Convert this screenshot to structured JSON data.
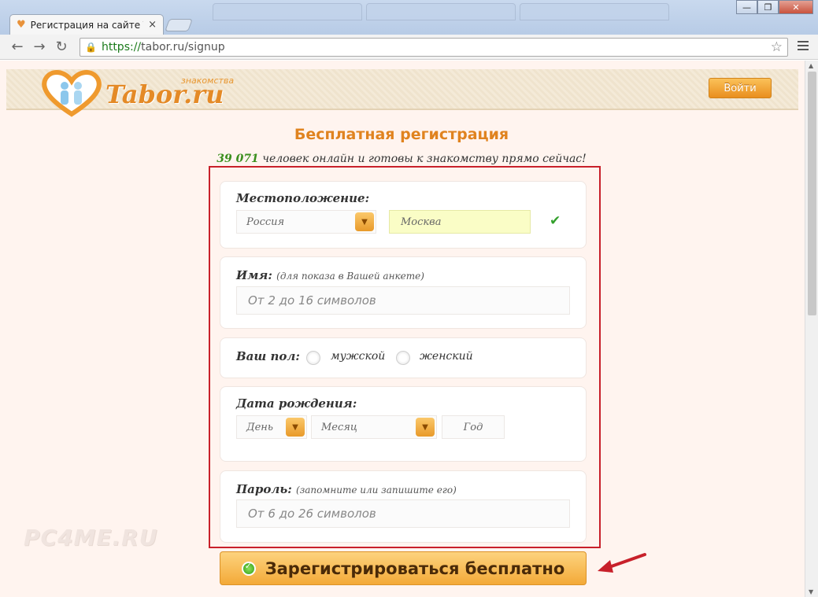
{
  "browser": {
    "tab_title": "Регистрация на сайте Tab",
    "tab_close": "×",
    "url_https": "https://",
    "url_rest": "tabor.ru/signup",
    "back_glyph": "←",
    "forward_glyph": "→",
    "reload_glyph": "↻",
    "star_glyph": "☆",
    "window_buttons": {
      "minimize": "—",
      "maximize": "❐",
      "close": "✕"
    }
  },
  "header": {
    "logo_text": "Tabor.ru",
    "logo_subtitle": "знакомства",
    "login_label": "Войти"
  },
  "page": {
    "title": "Бесплатная регистрация",
    "online_count": "39 071",
    "online_text": "человек онлайн и готовы к знакомству прямо сейчас!"
  },
  "form": {
    "location": {
      "label": "Местоположение:",
      "country": "Россия",
      "city": "Москва",
      "valid_glyph": "✔"
    },
    "name": {
      "label": "Имя:",
      "hint": "(для показа в Вашей анкете)",
      "placeholder": "От 2 до 16 символов"
    },
    "gender": {
      "label": "Ваш пол:",
      "male": "мужской",
      "female": "женский"
    },
    "birthdate": {
      "label": "Дата рождения:",
      "day": "День",
      "month": "Месяц",
      "year": "Год",
      "drop_glyph": "▼"
    },
    "password": {
      "label": "Пароль:",
      "hint": "(запомните или запишите его)",
      "placeholder": "От 6 до 26 символов"
    },
    "submit_label": "Зарегистрироваться бесплатно"
  },
  "watermark": "PC4ME.RU",
  "colors": {
    "accent": "#e0831f",
    "annotation_red": "#c8202a",
    "online_green": "#3a8f1e"
  }
}
